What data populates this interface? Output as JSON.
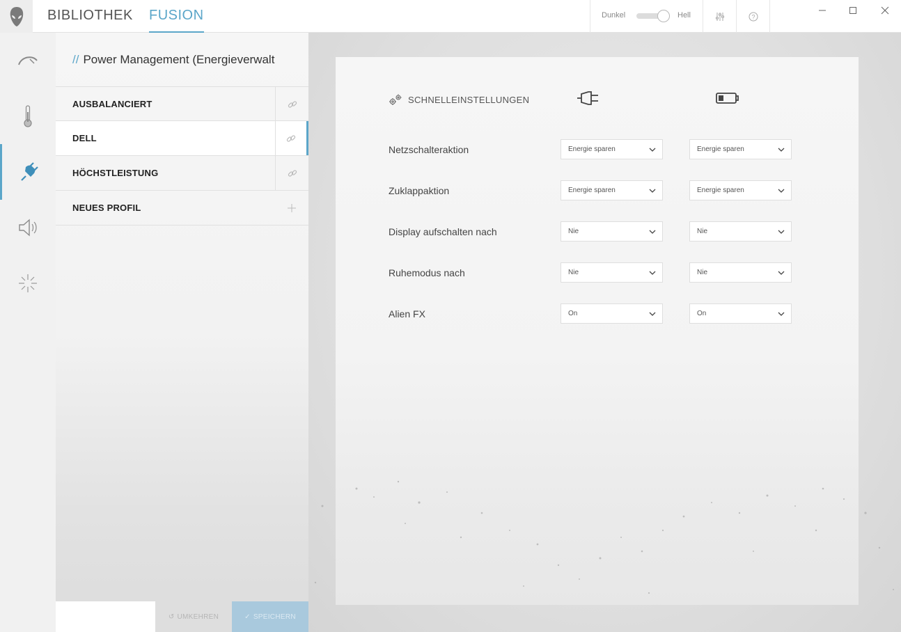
{
  "topbar": {
    "tabs": [
      {
        "label": "BIBLIOTHEK",
        "active": false
      },
      {
        "label": "FUSION",
        "active": true
      }
    ],
    "theme": {
      "left_label": "Dunkel",
      "right_label": "Hell",
      "selected": "Hell"
    },
    "icons": [
      "sliders-icon",
      "help-icon"
    ],
    "window_controls": [
      "minimize-icon",
      "maximize-icon",
      "close-icon"
    ]
  },
  "rail": {
    "items": [
      {
        "icon": "performance-gauge-icon",
        "active": false
      },
      {
        "icon": "thermometer-icon",
        "active": false
      },
      {
        "icon": "power-plug-icon",
        "active": true
      },
      {
        "icon": "speaker-icon",
        "active": false
      },
      {
        "icon": "lighting-burst-icon",
        "active": false
      }
    ]
  },
  "profiles": {
    "title_prefix": "//",
    "title": "Power Management (Energieverwalt",
    "items": [
      {
        "name": "AUSBALANCIERT",
        "action": "link-icon",
        "selected": false
      },
      {
        "name": "DELL",
        "action": "link-icon",
        "selected": true
      },
      {
        "name": "HÖCHSTLEISTUNG",
        "action": "link-icon",
        "selected": false
      },
      {
        "name": "NEUES PROFIL",
        "action": "plus-icon",
        "selected": false
      }
    ],
    "undo_label": "UMKEHREN",
    "save_label": "SPEICHERN"
  },
  "settings": {
    "header": "SCHNELLEINSTELLUNGEN",
    "columns": [
      "plugged-in-icon",
      "battery-icon"
    ],
    "rows": [
      {
        "label": "Netzschalteraktion",
        "ac": "Energie sparen",
        "dc": "Energie sparen"
      },
      {
        "label": "Zuklappaktion",
        "ac": "Energie sparen",
        "dc": "Energie sparen"
      },
      {
        "label": "Display aufschalten nach",
        "ac": "Nie",
        "dc": "Nie"
      },
      {
        "label": "Ruhemodus nach",
        "ac": "Nie",
        "dc": "Nie"
      },
      {
        "label": "Alien FX",
        "ac": "On",
        "dc": "On"
      }
    ]
  },
  "colors": {
    "accent": "#5ba6c9",
    "save_disabled": "#a9c9dd"
  }
}
